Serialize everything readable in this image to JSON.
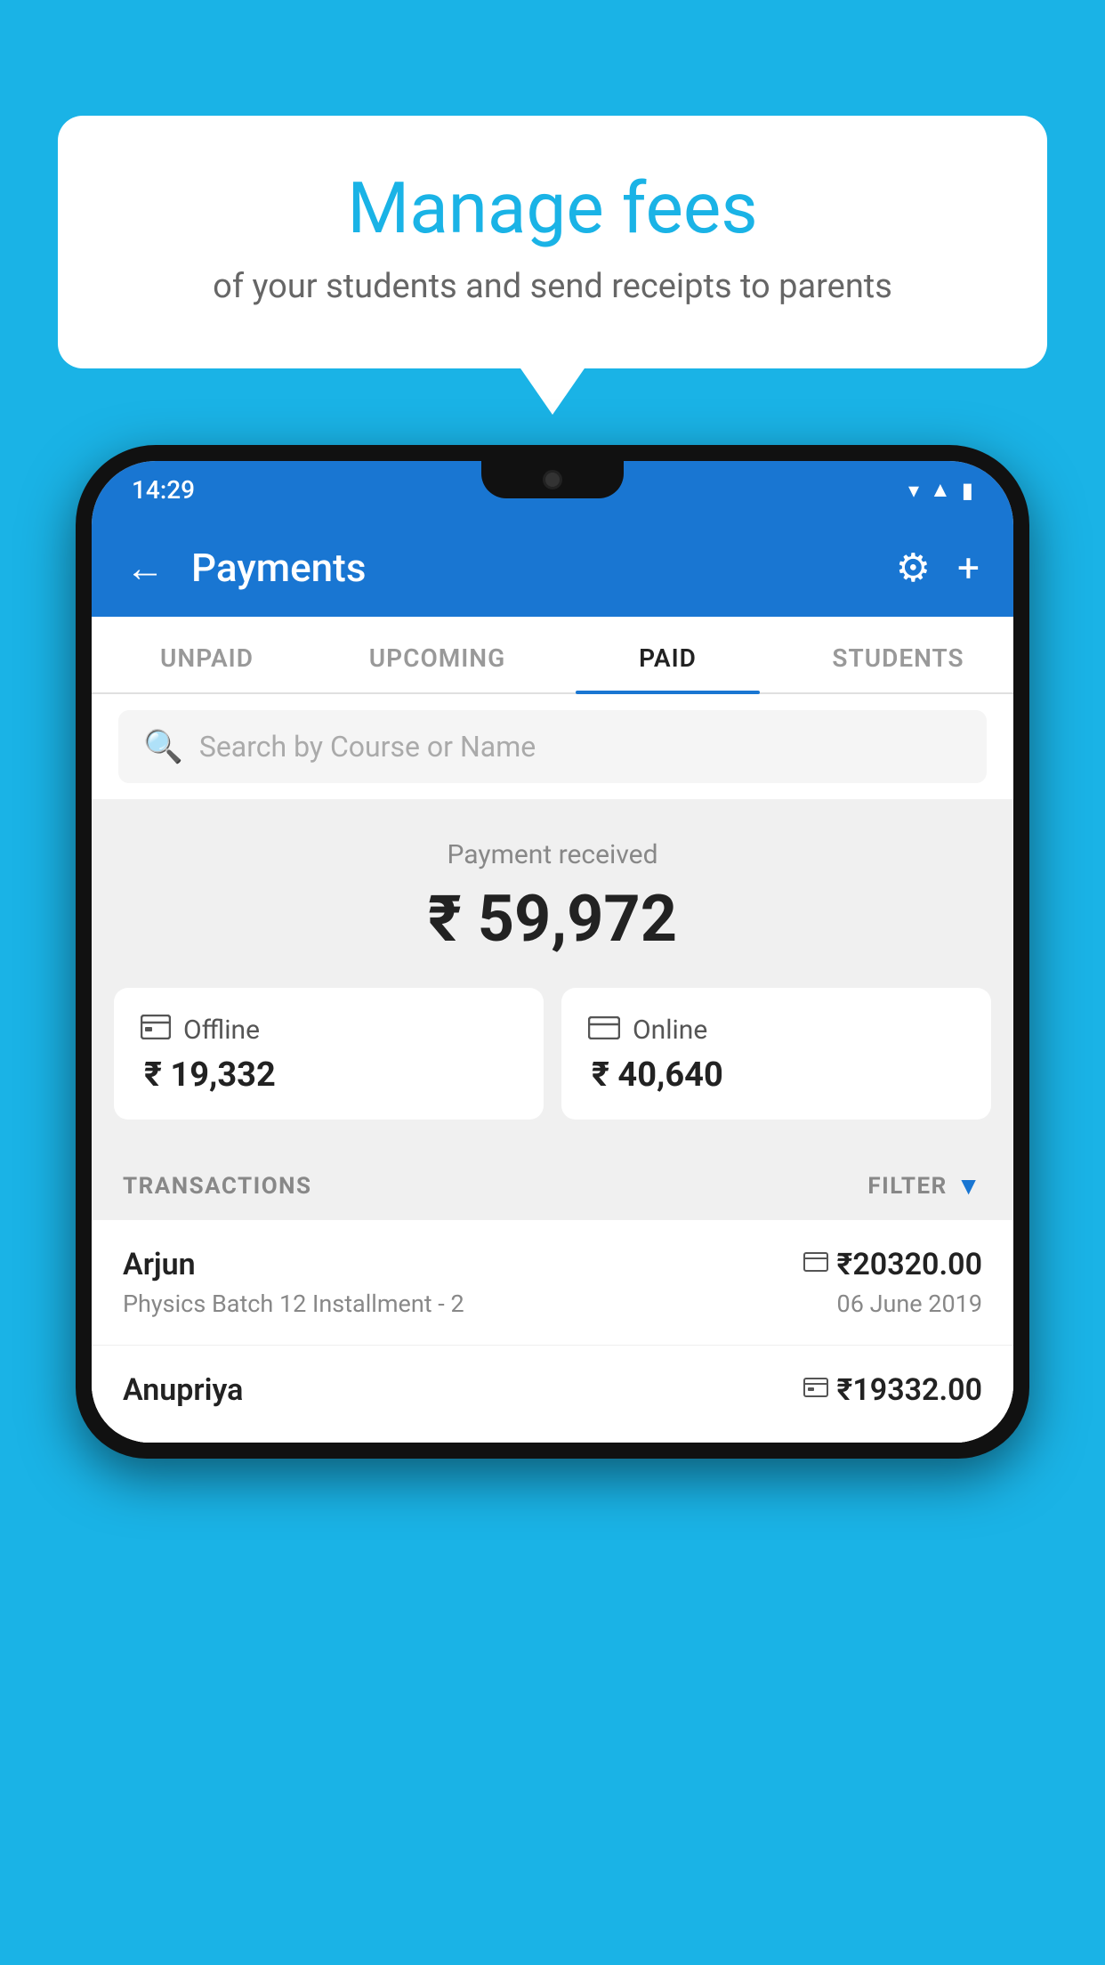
{
  "background": {
    "color": "#1ab3e6"
  },
  "speech_bubble": {
    "title": "Manage fees",
    "subtitle": "of your students and send receipts to parents"
  },
  "phone": {
    "status_bar": {
      "time": "14:29",
      "wifi_icon": "▾",
      "signal_icon": "▲",
      "battery_icon": "▮"
    },
    "app_bar": {
      "back_label": "←",
      "title": "Payments",
      "settings_icon": "⚙",
      "add_icon": "+"
    },
    "tabs": [
      {
        "label": "UNPAID",
        "active": false
      },
      {
        "label": "UPCOMING",
        "active": false
      },
      {
        "label": "PAID",
        "active": true
      },
      {
        "label": "STUDENTS",
        "active": false
      }
    ],
    "search": {
      "placeholder": "Search by Course or Name"
    },
    "payment_received": {
      "label": "Payment received",
      "amount": "₹ 59,972"
    },
    "offline_card": {
      "label": "Offline",
      "amount": "₹ 19,332"
    },
    "online_card": {
      "label": "Online",
      "amount": "₹ 40,640"
    },
    "transactions": {
      "header": "TRANSACTIONS",
      "filter_label": "FILTER",
      "items": [
        {
          "name": "Arjun",
          "amount": "₹20320.00",
          "course": "Physics Batch 12 Installment - 2",
          "date": "06 June 2019",
          "payment_type": "card"
        },
        {
          "name": "Anupriya",
          "amount": "₹19332.00",
          "course": "",
          "date": "",
          "payment_type": "cash"
        }
      ]
    }
  }
}
